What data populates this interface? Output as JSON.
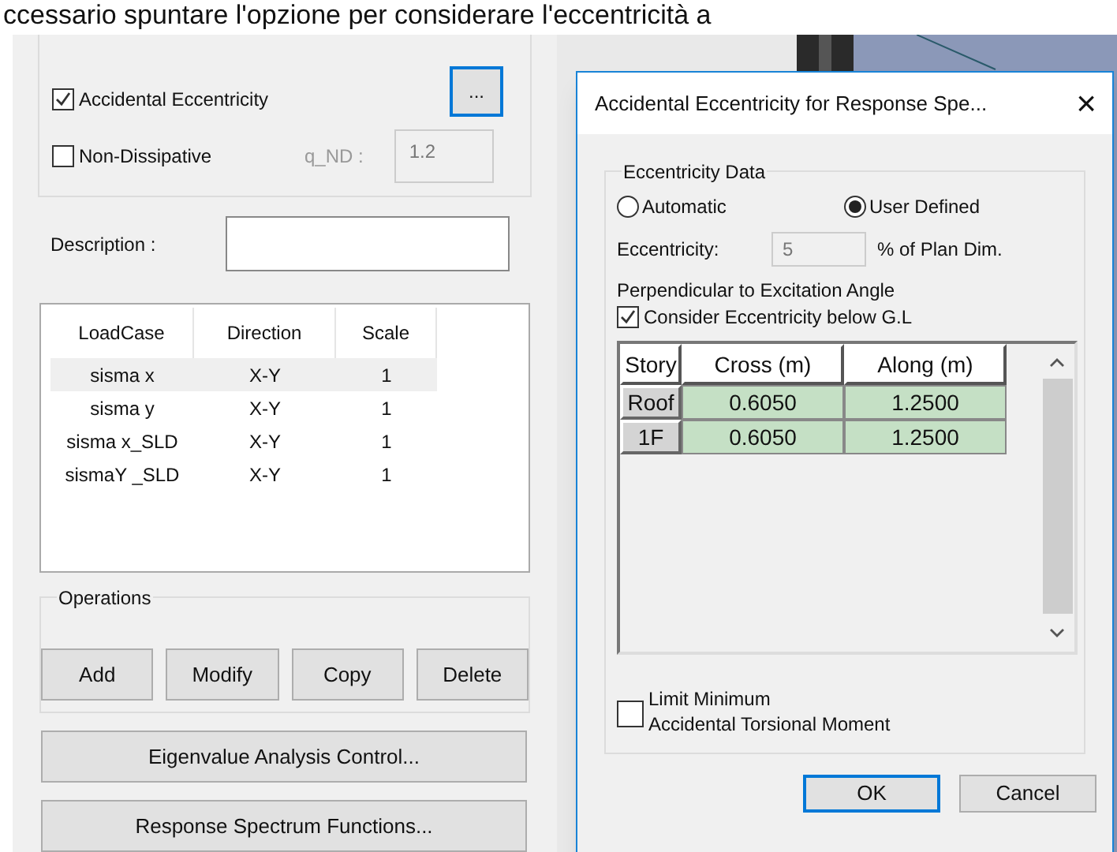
{
  "caption": "ccessario spuntare l'opzione per considerare l'eccentricità a",
  "options": [
    {
      "kind": "checkbox",
      "label": "Accidental Eccentricity",
      "checked": true
    },
    {
      "kind": "checkbox",
      "label": "Non-Dissipative",
      "checked": false
    }
  ],
  "more_button": "...",
  "q_nd": {
    "label": "q_ND :",
    "value": "1.2",
    "disabled": true
  },
  "description": {
    "label": "Description :"
  },
  "load_table": {
    "columns": [
      "LoadCase",
      "Direction",
      "Scale"
    ],
    "rows": [
      {
        "cells": [
          "sisma x",
          "X-Y",
          "1"
        ],
        "selected": true
      },
      {
        "cells": [
          "sisma y",
          "X-Y",
          "1"
        ],
        "selected": false
      },
      {
        "cells": [
          "sisma x_SLD",
          "X-Y",
          "1"
        ],
        "selected": false
      },
      {
        "cells": [
          "sismaY _SLD",
          "X-Y",
          "1"
        ],
        "selected": false
      }
    ]
  },
  "operations": {
    "title": "Operations",
    "buttons": [
      "Add",
      "Modify",
      "Copy",
      "Delete"
    ]
  },
  "bottom_buttons": [
    "Eigenvalue Analysis Control...",
    "Response Spectrum Functions..."
  ],
  "dialog": {
    "title": "Accidental Eccentricity for Response Spe...",
    "close": "×",
    "group_title": "Eccentricity Data",
    "radios": [
      {
        "label": "Automatic",
        "selected": false
      },
      {
        "label": "User Defined",
        "selected": true
      }
    ],
    "eccentricity": {
      "label": "Eccentricity:",
      "value": "5",
      "unit": "% of Plan Dim."
    },
    "perpendicular_label": "Perpendicular to Excitation Angle",
    "consider": {
      "label": "Consider Eccentricity below G.L",
      "checked": true
    },
    "grid": {
      "columns": [
        "Story",
        "Cross (m)",
        "Along (m)"
      ],
      "rows": [
        {
          "cells": [
            "Roof",
            "0.6050",
            "1.2500"
          ]
        },
        {
          "cells": [
            "1F",
            "0.6050",
            "1.2500"
          ]
        }
      ]
    },
    "limit": {
      "lines": [
        "Limit Minimum",
        "Accidental Torsional Moment"
      ],
      "checked": false
    },
    "buttons": [
      {
        "label": "OK",
        "default": true
      },
      {
        "label": "Cancel",
        "default": false
      }
    ]
  }
}
